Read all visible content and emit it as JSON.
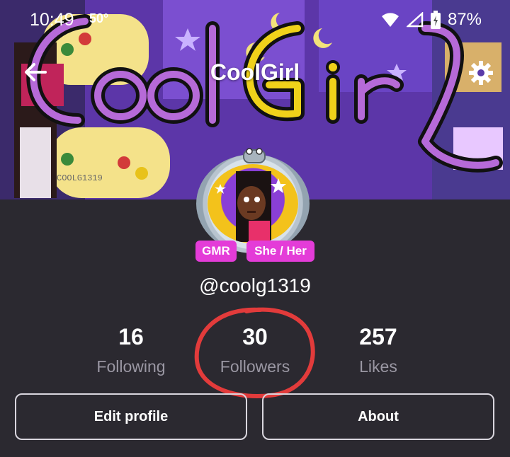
{
  "status_bar": {
    "time": "10:49",
    "temperature": "50°",
    "battery": "87%"
  },
  "header": {
    "title": "CoolGirl"
  },
  "banner": {
    "text": "CoolGirl",
    "tag": "COOLG1319"
  },
  "profile": {
    "badges": [
      "GMR",
      "She / Her"
    ],
    "username": "@coolg1319"
  },
  "stats": [
    {
      "value": "16",
      "label": "Following"
    },
    {
      "value": "30",
      "label": "Followers"
    },
    {
      "value": "257",
      "label": "Likes"
    }
  ],
  "actions": {
    "edit_label": "Edit profile",
    "about_label": "About"
  },
  "colors": {
    "background": "#2b2930",
    "badge": "#e43cd8",
    "annotation": "#e23b3b",
    "muted_text": "#9a97a3"
  },
  "icons": [
    "back-arrow-icon",
    "settings-gear-icon",
    "wifi-icon",
    "signal-icon",
    "battery-icon"
  ]
}
